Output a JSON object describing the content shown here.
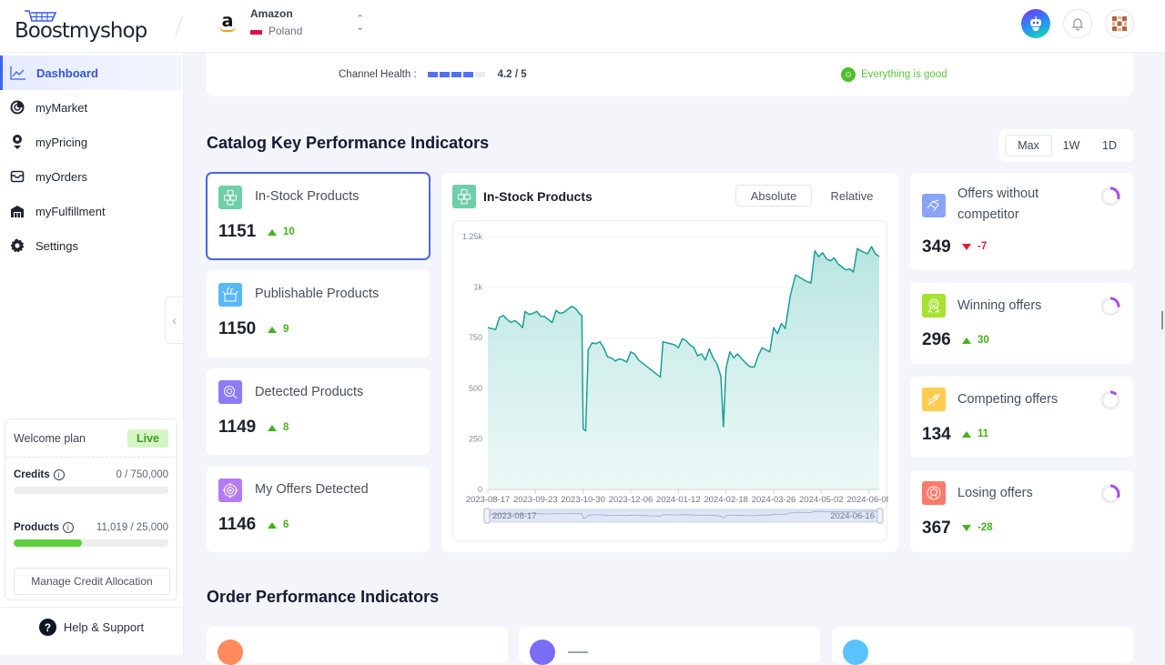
{
  "header": {
    "logo_text": "Boostmyshop",
    "channel": {
      "name": "Amazon",
      "country": "Poland"
    },
    "icons": [
      "bot-assistant-icon",
      "bell-icon",
      "user-avatar-icon"
    ]
  },
  "sidebar": {
    "items": [
      {
        "label": "Dashboard",
        "icon": "chart-line-icon",
        "active": true
      },
      {
        "label": "myMarket",
        "icon": "radar-icon"
      },
      {
        "label": "myPricing",
        "icon": "price-pin-icon"
      },
      {
        "label": "myOrders",
        "icon": "inbox-icon"
      },
      {
        "label": "myFulfillment",
        "icon": "warehouse-icon"
      },
      {
        "label": "Settings",
        "icon": "gear-icon"
      }
    ],
    "plan": {
      "name": "Welcome plan",
      "status": "Live",
      "credits_label": "Credits",
      "credits_value": "0 / 750,000",
      "credits_fraction": 0,
      "products_label": "Products",
      "products_value": "11,019 / 25,000",
      "products_fraction": 0.44,
      "manage_label": "Manage Credit Allocation"
    },
    "help_label": "Help & Support"
  },
  "health": {
    "label": "Channel Health :",
    "score": "4.2 / 5",
    "score_value": 4.2,
    "score_max": 5,
    "status": "Everything is good"
  },
  "catalog": {
    "title": "Catalog Key Performance Indicators",
    "ranges": [
      "Max",
      "1W",
      "1D"
    ],
    "active_range": "Max",
    "left_cards": [
      {
        "label": "In-Stock Products",
        "value": "1151",
        "delta": "10",
        "direction": "up",
        "color": "#6fcfa8",
        "icon": "boxes-icon",
        "selected": true
      },
      {
        "label": "Publishable Products",
        "value": "1150",
        "delta": "9",
        "direction": "up",
        "color": "#5ab8f5",
        "icon": "open-box-icon"
      },
      {
        "label": "Detected Products",
        "value": "1149",
        "delta": "8",
        "direction": "up",
        "color": "#8b7cf6",
        "icon": "magnifier-box-icon"
      },
      {
        "label": "My Offers Detected",
        "value": "1146",
        "delta": "6",
        "direction": "up",
        "color": "#b57bf2",
        "icon": "target-icon"
      }
    ],
    "right_cards": [
      {
        "label": "Offers without competitor",
        "value": "349",
        "delta": "-7",
        "direction": "down",
        "delta_color": "#e11d2b",
        "color": "#8aa4f5",
        "icon": "handshake-icon",
        "share": 0.3
      },
      {
        "label": "Winning offers",
        "value": "296",
        "delta": "30",
        "direction": "up",
        "delta_color": "#43b21c",
        "color": "#a6e22e",
        "icon": "award-icon",
        "share": 0.26
      },
      {
        "label": "Competing offers",
        "value": "134",
        "delta": "11",
        "direction": "up",
        "delta_color": "#43b21c",
        "color": "#ffcc4d",
        "icon": "rocket-icon",
        "share": 0.12
      },
      {
        "label": "Losing offers",
        "value": "367",
        "delta": "-28",
        "direction": "down",
        "delta_color": "#43b21c",
        "color": "#ff7a6b",
        "icon": "medal-icon",
        "share": 0.32
      }
    ],
    "chart": {
      "title": "In-Stock Products",
      "modes": [
        "Absolute",
        "Relative"
      ],
      "active_mode": "Absolute",
      "zoom_start": "2023-08-17",
      "zoom_end": "2024-06-16"
    }
  },
  "orders": {
    "title": "Order Performance Indicators",
    "card_colors": [
      "#ff8a5b",
      "#7b6cf6",
      "#5ac3fb"
    ]
  },
  "chart_data": {
    "type": "area",
    "title": "In-Stock Products",
    "xlabel": "",
    "ylabel": "",
    "ylim": [
      0,
      1250
    ],
    "yticks": [
      0,
      250,
      500,
      750,
      "1k",
      "1.25k"
    ],
    "ytick_values": [
      0,
      250,
      500,
      750,
      1000,
      1250
    ],
    "xticks": [
      "2023-08-17",
      "2023-09-23",
      "2023-10-30",
      "2023-12-06",
      "2024-01-12",
      "2024-02-18",
      "2024-03-26",
      "2024-05-02",
      "2024-06-08"
    ],
    "xrange": [
      "2023-08-17",
      "2024-06-16"
    ],
    "grid": true,
    "series": [
      {
        "name": "In-Stock Products",
        "color": "#1a9e98",
        "points": [
          [
            "2023-08-17",
            800
          ],
          [
            "2023-08-20",
            795
          ],
          [
            "2023-08-23",
            790
          ],
          [
            "2023-08-26",
            850
          ],
          [
            "2023-08-29",
            860
          ],
          [
            "2023-09-01",
            840
          ],
          [
            "2023-09-04",
            825
          ],
          [
            "2023-09-07",
            835
          ],
          [
            "2023-09-10",
            820
          ],
          [
            "2023-09-13",
            800
          ],
          [
            "2023-09-15",
            880
          ],
          [
            "2023-09-18",
            865
          ],
          [
            "2023-09-21",
            870
          ],
          [
            "2023-09-24",
            880
          ],
          [
            "2023-09-27",
            855
          ],
          [
            "2023-09-30",
            855
          ],
          [
            "2023-10-03",
            840
          ],
          [
            "2023-10-06",
            825
          ],
          [
            "2023-10-09",
            885
          ],
          [
            "2023-10-12",
            870
          ],
          [
            "2023-10-15",
            875
          ],
          [
            "2023-10-18",
            890
          ],
          [
            "2023-10-21",
            905
          ],
          [
            "2023-10-24",
            895
          ],
          [
            "2023-10-27",
            870
          ],
          [
            "2023-10-29",
            860
          ],
          [
            "2023-10-30",
            300
          ],
          [
            "2023-11-01",
            290
          ],
          [
            "2023-11-03",
            690
          ],
          [
            "2023-11-06",
            725
          ],
          [
            "2023-11-09",
            720
          ],
          [
            "2023-11-12",
            730
          ],
          [
            "2023-11-15",
            700
          ],
          [
            "2023-11-18",
            655
          ],
          [
            "2023-11-21",
            650
          ],
          [
            "2023-11-24",
            635
          ],
          [
            "2023-11-27",
            645
          ],
          [
            "2023-11-30",
            640
          ],
          [
            "2023-12-03",
            630
          ],
          [
            "2023-12-06",
            680
          ],
          [
            "2023-12-09",
            670
          ],
          [
            "2023-12-12",
            640
          ],
          [
            "2023-12-15",
            625
          ],
          [
            "2023-12-18",
            610
          ],
          [
            "2023-12-21",
            595
          ],
          [
            "2023-12-24",
            580
          ],
          [
            "2023-12-27",
            565
          ],
          [
            "2023-12-29",
            555
          ],
          [
            "2023-12-31",
            730
          ],
          [
            "2024-01-03",
            725
          ],
          [
            "2024-01-06",
            720
          ],
          [
            "2024-01-09",
            715
          ],
          [
            "2024-01-12",
            700
          ],
          [
            "2024-01-15",
            745
          ],
          [
            "2024-01-18",
            735
          ],
          [
            "2024-01-21",
            715
          ],
          [
            "2024-01-24",
            700
          ],
          [
            "2024-01-27",
            660
          ],
          [
            "2024-01-30",
            670
          ],
          [
            "2024-02-02",
            640
          ],
          [
            "2024-02-05",
            695
          ],
          [
            "2024-02-08",
            650
          ],
          [
            "2024-02-11",
            620
          ],
          [
            "2024-02-14",
            560
          ],
          [
            "2024-02-16",
            310
          ],
          [
            "2024-02-18",
            600
          ],
          [
            "2024-02-21",
            680
          ],
          [
            "2024-02-24",
            650
          ],
          [
            "2024-02-27",
            670
          ],
          [
            "2024-03-02",
            640
          ],
          [
            "2024-03-05",
            620
          ],
          [
            "2024-03-08",
            605
          ],
          [
            "2024-03-11",
            605
          ],
          [
            "2024-03-14",
            660
          ],
          [
            "2024-03-17",
            700
          ],
          [
            "2024-03-20",
            690
          ],
          [
            "2024-03-23",
            680
          ],
          [
            "2024-03-26",
            800
          ],
          [
            "2024-03-29",
            770
          ],
          [
            "2024-04-01",
            820
          ],
          [
            "2024-04-04",
            795
          ],
          [
            "2024-04-08",
            960
          ],
          [
            "2024-04-12",
            1060
          ],
          [
            "2024-04-16",
            1045
          ],
          [
            "2024-04-20",
            1030
          ],
          [
            "2024-04-24",
            1020
          ],
          [
            "2024-04-27",
            1180
          ],
          [
            "2024-04-30",
            1150
          ],
          [
            "2024-05-03",
            1170
          ],
          [
            "2024-05-06",
            1140
          ],
          [
            "2024-05-09",
            1130
          ],
          [
            "2024-05-12",
            1145
          ],
          [
            "2024-05-15",
            1115
          ],
          [
            "2024-05-18",
            1100
          ],
          [
            "2024-05-21",
            1085
          ],
          [
            "2024-05-24",
            1090
          ],
          [
            "2024-05-27",
            1075
          ],
          [
            "2024-05-30",
            1190
          ],
          [
            "2024-06-03",
            1175
          ],
          [
            "2024-06-07",
            1165
          ],
          [
            "2024-06-10",
            1200
          ],
          [
            "2024-06-13",
            1165
          ],
          [
            "2024-06-16",
            1151
          ]
        ]
      }
    ]
  }
}
